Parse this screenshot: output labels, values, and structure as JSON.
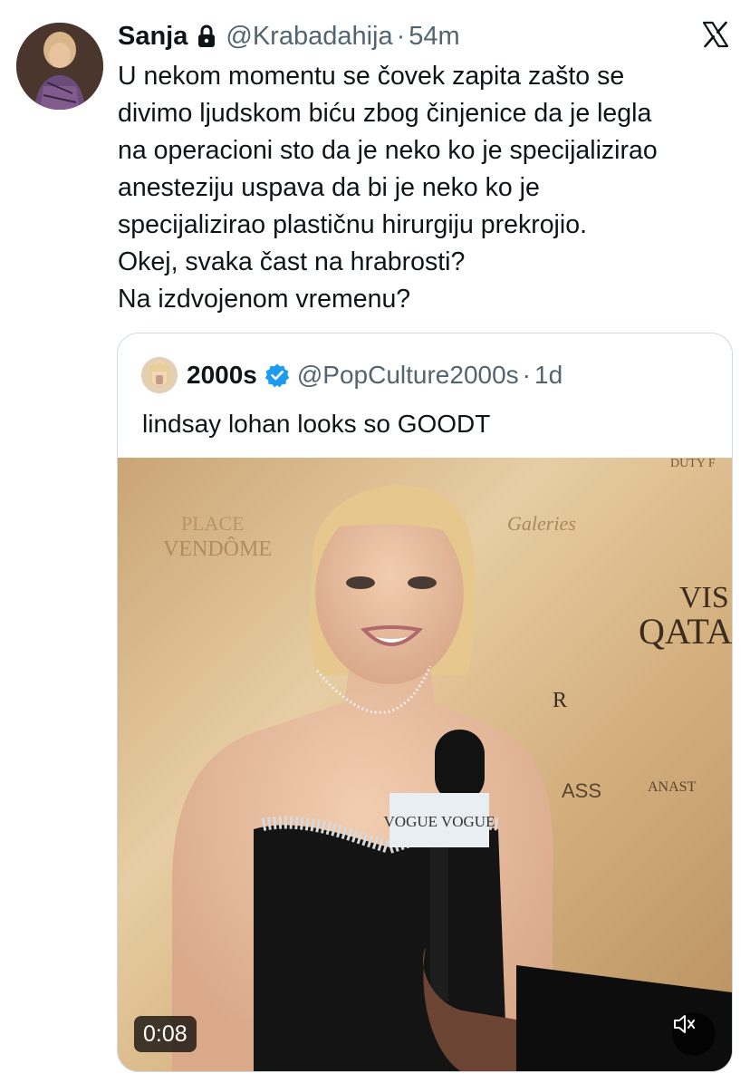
{
  "tweet": {
    "display_name": "Sanja",
    "handle": "@Krabadahija",
    "separator": "·",
    "time": "54m",
    "protected": true,
    "avatar_icon": "user-avatar-photo",
    "text_lines": [
      "U nekom momentu se čovek zapita zašto se",
      "divimo ljudskom biću zbog činjenice da je legla",
      "na operacioni sto da je neko ko je specijalizirao",
      "anesteziju uspava da bi je neko ko je",
      "specijalizirao plastičnu hirurgiju prekrojio.",
      "Okej, svaka čast na hrabrosti?",
      "Na izdvojenom vremenu?"
    ]
  },
  "brand": {
    "logo_icon": "x-logo-icon"
  },
  "quoted": {
    "display_name": "2000s",
    "verified": true,
    "verified_color": "#1d9bf0",
    "handle": "@PopCulture2000s",
    "separator": "·",
    "time": "1d",
    "text": "lindsay lohan looks so GOODT",
    "media": {
      "type": "video",
      "duration": "0:08",
      "mic_flag_text": "VOGUE VOGUE",
      "mute_icon": "speaker-muted-icon"
    }
  }
}
